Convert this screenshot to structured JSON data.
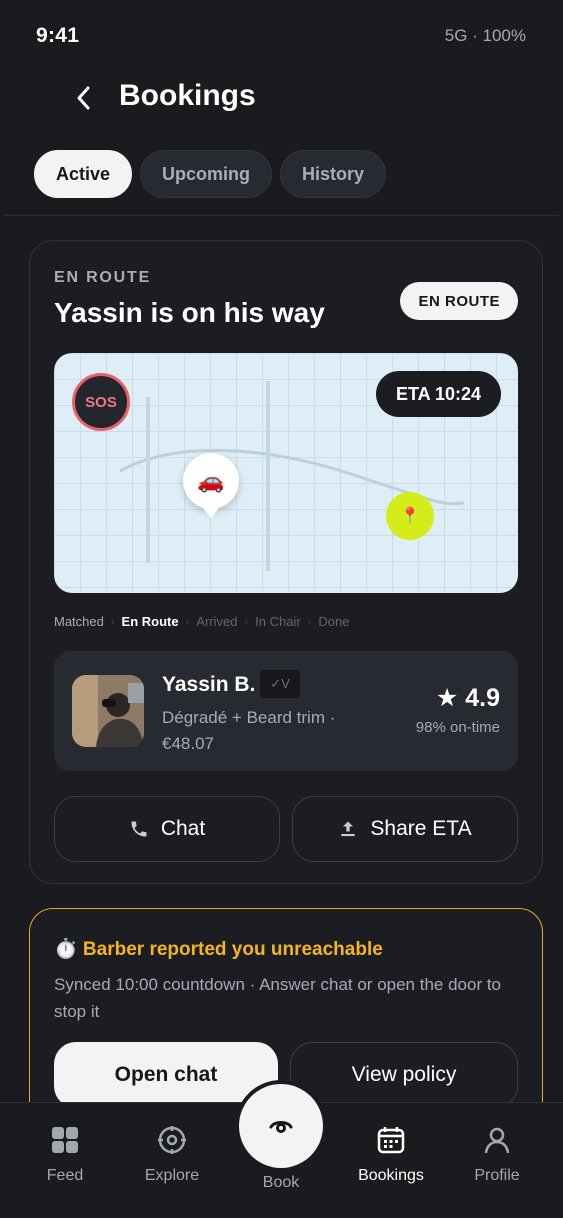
{
  "status_bar": {
    "time": "9:41",
    "network": "5G · 100%"
  },
  "header": {
    "title": "Bookings"
  },
  "tabs": [
    {
      "label": "Active",
      "active": true
    },
    {
      "label": "Upcoming",
      "active": false
    },
    {
      "label": "History",
      "active": false
    }
  ],
  "booking": {
    "eyebrow": "EN ROUTE",
    "title": "Yassin is on his way",
    "badge": "EN ROUTE",
    "map": {
      "sos": "SOS",
      "eta": "ETA 10:24",
      "car_glyph": "🚗",
      "dest_glyph": "📍"
    },
    "progress": [
      {
        "label": "Matched",
        "state": "done"
      },
      {
        "label": "En Route",
        "state": "current"
      },
      {
        "label": "Arrived",
        "state": "pending"
      },
      {
        "label": "In Chair",
        "state": "pending"
      },
      {
        "label": "Done",
        "state": "pending"
      }
    ],
    "barber": {
      "name": "Yassin B.",
      "verified": "✓V",
      "service": "Dégradé + Beard trim · €48.07",
      "rating": "★ 4.9",
      "on_time": "98% on-time"
    },
    "actions": {
      "chat": "Chat",
      "share": "Share ETA"
    }
  },
  "alert": {
    "title": "⏱️ Barber reported you unreachable",
    "text": "Synced 10:00 countdown · Answer chat or open the door to stop it",
    "primary": "Open chat",
    "secondary": "View policy",
    "accent": "#f3b420"
  },
  "nav": {
    "feed": "Feed",
    "explore": "Explore",
    "book": "Book",
    "bookings": "Bookings",
    "profile": "Profile",
    "active": "bookings"
  }
}
